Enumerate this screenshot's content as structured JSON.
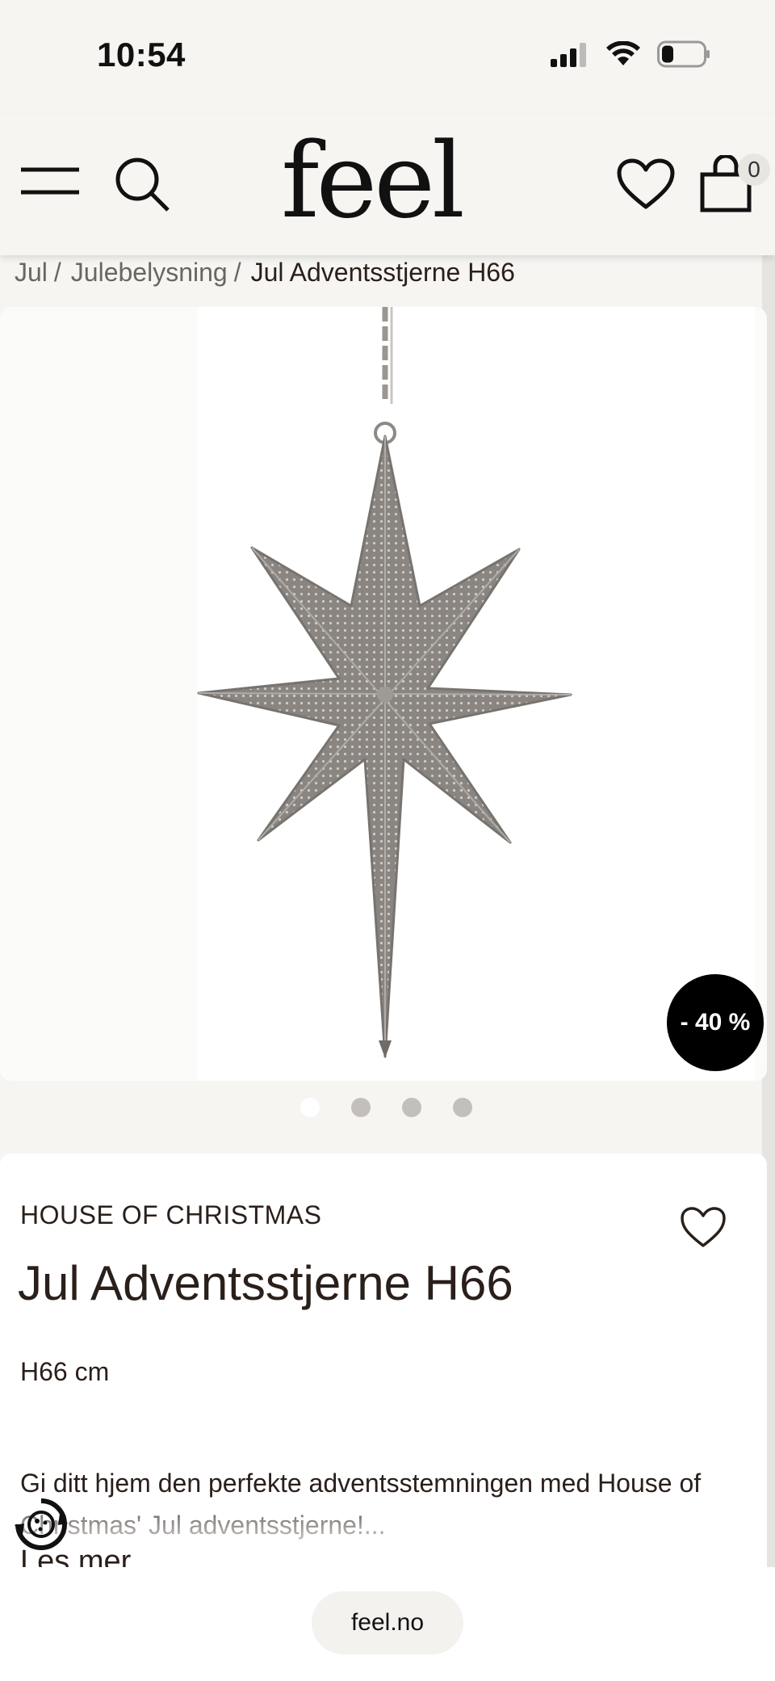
{
  "status_bar": {
    "time": "10:54"
  },
  "header": {
    "logo": "feel",
    "cart_count": "0",
    "icons": [
      "hamburger-icon",
      "search-icon",
      "heart-icon",
      "shopping-bag-icon"
    ]
  },
  "breadcrumb": {
    "items": [
      "Jul",
      "Julebelysning"
    ],
    "current": "Jul Adventsstjerne H66",
    "separator": "/"
  },
  "gallery": {
    "discount": "- 40 %",
    "dots": 4,
    "active_dot": 0
  },
  "product": {
    "brand": "HOUSE OF CHRISTMAS",
    "title": "Jul Adventsstjerne H66",
    "size": "H66 cm",
    "description": "Gi ditt hjem den perfekte adventsstemningen med House of Christmas' Jul adventsstjerne!...",
    "read_more": "Les mer"
  },
  "browser": {
    "url": "feel.no"
  },
  "colors": {
    "background": "#f6f5f2",
    "badge": "#000000",
    "text": "#2a1f1a"
  }
}
